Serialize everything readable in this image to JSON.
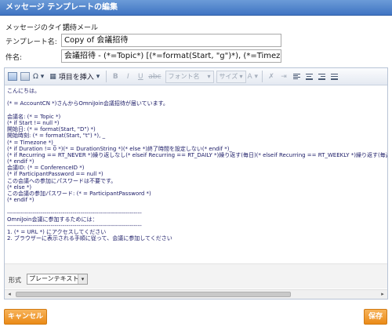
{
  "window": {
    "title": "メッセージ テンプレートの編集"
  },
  "fields": {
    "type_label": "メッセージのタイプ:",
    "type_value": "招待メール",
    "name_label": "テンプレート名:",
    "name_value": "Copy of 会議招待",
    "subject_label": "件名:",
    "subject_value": "会議招待 - (*=Topic*) [(*=format(Start, \"g\")*), (*=Timezone*)] 議長: (*=A"
  },
  "toolbar": {
    "insert_item_label": "項目を挿入",
    "font_placeholder": "フォント名",
    "size_placeholder": "サイズ"
  },
  "editor_lines": [
    "こんにちは。",
    "",
    "(* = AccountCN *)さんからOmniJoin会議招待が届いています。",
    "",
    "会議名: (* = Topic *)",
    "(* if Start != null *)",
    "開始日: (* = format(Start, \"D\") *)",
    "開始時刻: (* = format(Start, \"t\") *), _",
    "(* = Timezone *)_",
    "(* if Duration != 0 *)(* = DurationString *)(* else *)終了時間を設定しない(* endif *)_",
    "(* if Recurring == RT_NEVER *)繰り返しなし(* elseif Recurring == RT_DAILY *)繰り返す(毎日)(* elseif Recurring == RT_WEEKLY *)繰り返す(毎週)",
    "(* endif *)",
    "会議ID: (* = ConferenceID *)",
    "(* if ParticipantPassword == null *)",
    "この会議への参加にパスワードは不要です。",
    "(* else *)",
    "この会議の参加パスワード: (* = ParticipantPassword *)",
    "(* endif *)",
    "",
    "--------------------------------------------------------------------",
    "OmniJoin会議に参加するためには：",
    "--------------------------------------------------------------------",
    "1. (* = URL *) にアクセスしてください",
    "2. ブラウザーに表示される手順に従って、会議に参加してください"
  ],
  "format": {
    "label": "形式",
    "value": "プレーンテキスト"
  },
  "buttons": {
    "cancel": "キャンセル",
    "save": "保存"
  }
}
